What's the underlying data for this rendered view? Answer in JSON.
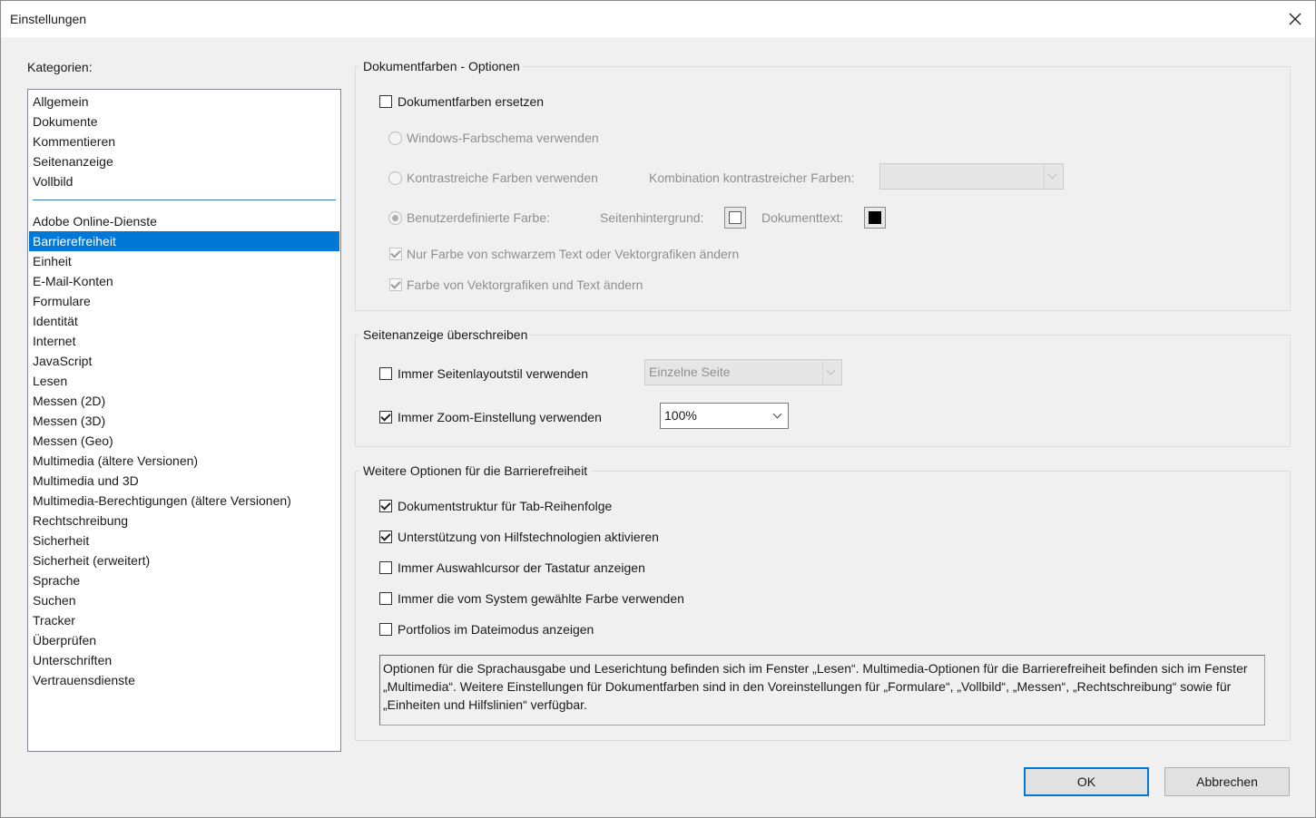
{
  "window": {
    "title": "Einstellungen"
  },
  "categories": {
    "label": "Kategorien:",
    "top_items": [
      "Allgemein",
      "Dokumente",
      "Kommentieren",
      "Seitenanzeige",
      "Vollbild"
    ],
    "items": [
      "Adobe Online-Dienste",
      "Barrierefreiheit",
      "Einheit",
      "E-Mail-Konten",
      "Formulare",
      "Identität",
      "Internet",
      "JavaScript",
      "Lesen",
      "Messen (2D)",
      "Messen (3D)",
      "Messen (Geo)",
      "Multimedia (ältere Versionen)",
      "Multimedia und 3D",
      "Multimedia-Berechtigungen (ältere Versionen)",
      "Rechtschreibung",
      "Sicherheit",
      "Sicherheit (erweitert)",
      "Sprache",
      "Suchen",
      "Tracker",
      "Überprüfen",
      "Unterschriften",
      "Vertrauensdienste"
    ],
    "selected": "Barrierefreiheit"
  },
  "doc_colors": {
    "legend": "Dokumentfarben - Optionen",
    "replace": {
      "label": "Dokumentfarben ersetzen",
      "checked": false
    },
    "windows_scheme": {
      "label": "Windows-Farbschema verwenden",
      "selected": false
    },
    "high_contrast": {
      "label": "Kontrastreiche Farben verwenden",
      "selected": false
    },
    "combination": {
      "label": "Kombination kontrastreicher Farben:",
      "value": ""
    },
    "custom": {
      "label": "Benutzerdefinierte Farbe:",
      "selected": true
    },
    "page_background": {
      "label": "Seitenhintergrund:",
      "color": "#ffffff"
    },
    "doc_text": {
      "label": "Dokumenttext:",
      "color": "#000000"
    },
    "only_black": {
      "label": "Nur Farbe von schwarzem Text oder Vektorgrafiken ändern",
      "checked": true
    },
    "vector": {
      "label": "Farbe von Vektorgrafiken und Text ändern",
      "checked": true
    }
  },
  "page_display": {
    "legend": "Seitenanzeige überschreiben",
    "layout": {
      "label": "Immer Seitenlayoutstil verwenden",
      "checked": false,
      "value": "Einzelne Seite"
    },
    "zoom": {
      "label": "Immer Zoom-Einstellung verwenden",
      "checked": true,
      "value": "100%"
    }
  },
  "more": {
    "legend": "Weitere Optionen für die Barrierefreiheit",
    "options": [
      {
        "label": "Dokumentstruktur für Tab-Reihenfolge",
        "checked": true
      },
      {
        "label": "Unterstützung von Hilfstechnologien aktivieren",
        "checked": true
      },
      {
        "label": "Immer Auswahlcursor der Tastatur anzeigen",
        "checked": false
      },
      {
        "label": "Immer die vom System gewählte Farbe verwenden",
        "checked": false
      },
      {
        "label": "Portfolios im Dateimodus anzeigen",
        "checked": false
      }
    ],
    "info": "Optionen für die Sprachausgabe und Leserichtung befinden sich im Fenster „Lesen“. Multimedia-Optionen für die Barrierefreiheit befinden sich im Fenster „Multimedia“. Weitere Einstellungen für Dokumentfarben sind in den Voreinstellungen für „Formulare“, „Vollbild“, „Messen“, „Rechtschreibung“ sowie für „Einheiten und Hilfslinien“ verfügbar."
  },
  "buttons": {
    "ok": "OK",
    "cancel": "Abbrechen"
  },
  "colors": {
    "accent": "#0078d7",
    "background": "#f0f0f0"
  }
}
